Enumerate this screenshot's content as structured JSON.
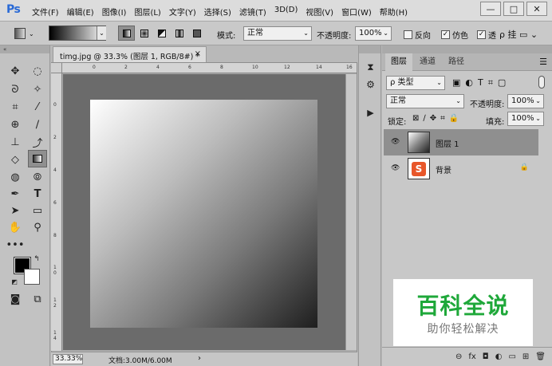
{
  "app": {
    "logo": "Ps"
  },
  "menu": [
    "文件(F)",
    "编辑(E)",
    "图像(I)",
    "图层(L)",
    "文字(Y)",
    "选择(S)",
    "滤镜(T)",
    "3D(D)",
    "视图(V)",
    "窗口(W)",
    "帮助(H)"
  ],
  "window_buttons": {
    "minimize": "—",
    "restore": "□",
    "close": "✕"
  },
  "options": {
    "mode_label": "模式:",
    "mode_value": "正常",
    "opacity_label": "不透明度:",
    "opacity_value": "100%",
    "reverse_label": "反向",
    "dither_label": "仿色",
    "transparency_label": "透"
  },
  "document": {
    "tab_title": "timg.jpg @ 33.3% (图层 1, RGB/8#) *",
    "close": "×",
    "ruler_h": [
      "0",
      "2",
      "4",
      "6",
      "8",
      "10",
      "12",
      "14",
      "16"
    ],
    "ruler_v": [
      "0",
      "2",
      "4",
      "6",
      "8",
      "1 0",
      "1 2",
      "1 4"
    ],
    "zoom": "33.33%",
    "doc_info": "文档:3.00M/6.00M",
    "status_arrow": "›"
  },
  "layers_panel": {
    "tabs": [
      "图层",
      "通道",
      "路径"
    ],
    "active_tab": "图层",
    "filter_label": "ρ 类型",
    "blend_mode": "正常",
    "opacity_label": "不透明度:",
    "opacity_value": "100%",
    "lock_label": "锁定:",
    "fill_label": "填充:",
    "fill_value": "100%",
    "layers": [
      {
        "name": "图层 1",
        "selected": true
      },
      {
        "name": "背景",
        "selected": false
      }
    ],
    "footer": [
      "⊖",
      "fx",
      "◘",
      "◐",
      "▭",
      "⊞",
      "🗑"
    ]
  },
  "watermark": {
    "main": "百科全说",
    "sub": "助你轻松解决"
  }
}
